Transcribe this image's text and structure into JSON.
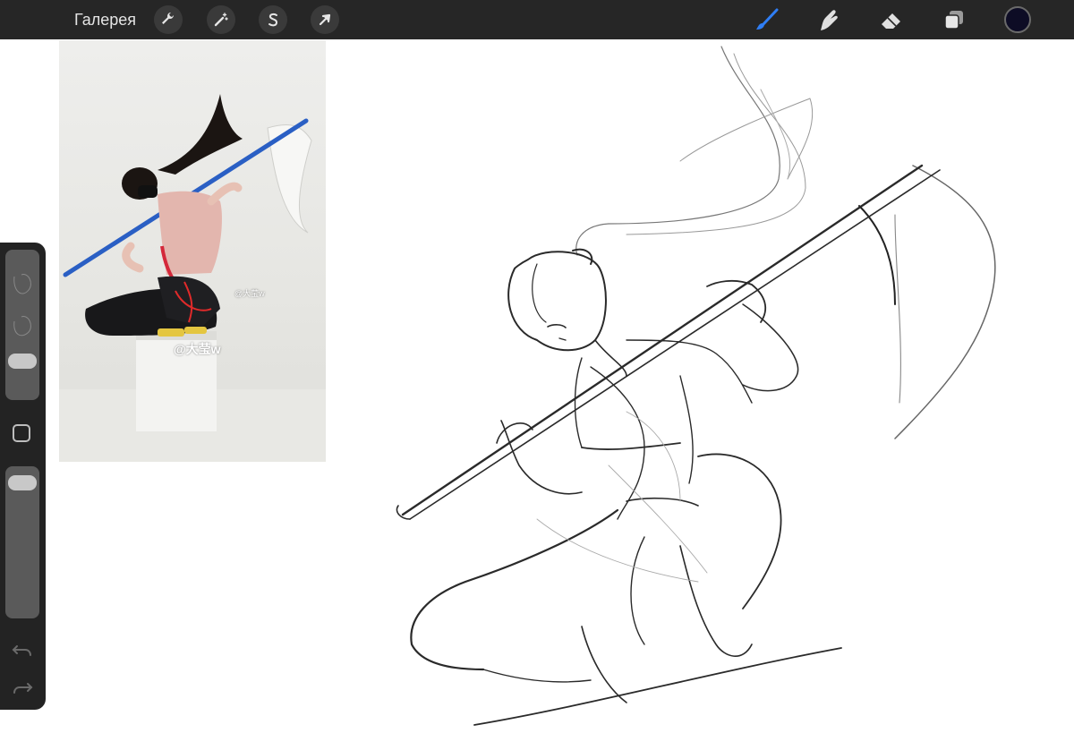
{
  "toolbar": {
    "gallery_label": "Галерея",
    "left_tools": [
      {
        "name": "actions",
        "icon": "wrench-icon"
      },
      {
        "name": "adjustments",
        "icon": "magic-wand-icon"
      },
      {
        "name": "selection",
        "icon": "selection-s-icon"
      },
      {
        "name": "transform",
        "icon": "arrow-cursor-icon"
      }
    ],
    "right_tools": [
      {
        "name": "brush",
        "icon": "brush-icon",
        "active": true
      },
      {
        "name": "smudge",
        "icon": "smudge-finger-icon"
      },
      {
        "name": "eraser",
        "icon": "eraser-icon"
      },
      {
        "name": "layers",
        "icon": "layers-icon"
      }
    ],
    "current_color": "#0d0c25",
    "accent_color": "#2f7ef5"
  },
  "reference": {
    "watermark": "@大莹w",
    "watermark_small": "@大莹w"
  },
  "sidebar": {
    "brush_size_level": 0.22,
    "opacity_level": 0.95,
    "undo_icon": "undo-arrow-icon",
    "redo_icon": "redo-arrow-icon",
    "modify_icon": "square-modify-icon"
  }
}
